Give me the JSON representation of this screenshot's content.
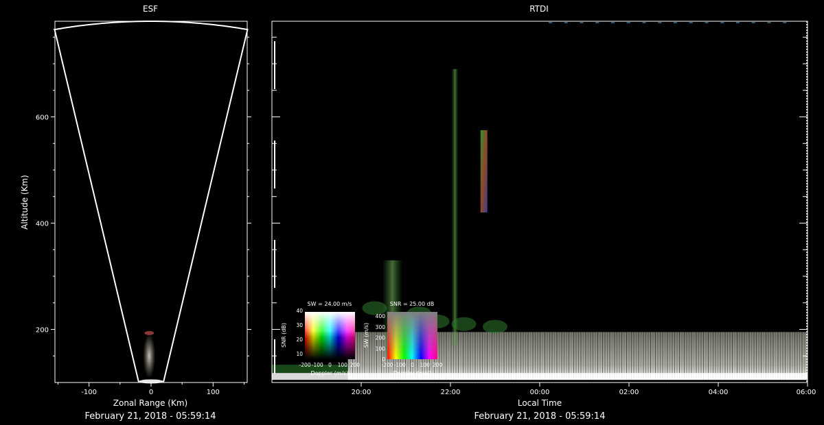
{
  "chart_data": [
    {
      "type": "heatmap",
      "panel": "esf",
      "title": "ESF",
      "xlabel": "Zonal Range (Km)",
      "ylabel": "Altitude (Km)",
      "xlim": [
        -155,
        155
      ],
      "ylim": [
        100,
        780
      ],
      "xticks": [
        -100,
        0,
        100
      ],
      "yticks": [
        200,
        400,
        600
      ],
      "grid": false,
      "beam_half_angle_deg": 11.5,
      "max_range_km": 780,
      "footer": "February 21, 2018 - 05:59:14"
    },
    {
      "type": "heatmap",
      "panel": "rtdi",
      "title": "RTDI",
      "xlabel": "Local Time",
      "xlim_hours": [
        18.0,
        30.0
      ],
      "xticks": [
        "20:00",
        "22:00",
        "00:00",
        "02:00",
        "04:00",
        "06:00"
      ],
      "xtick_hours": [
        20,
        22,
        24,
        26,
        28,
        30
      ],
      "ylim": [
        100,
        780
      ],
      "grid": false,
      "footer": "February 21, 2018 - 05:59:14",
      "features": [
        {
          "kind": "bottomside-layer",
          "start_hour": 19.7,
          "end_hour": 30.0,
          "alt_low": 105,
          "alt_high": 195
        },
        {
          "kind": "plume",
          "hour": 22.1,
          "alt_low": 170,
          "alt_high": 690
        },
        {
          "kind": "plume",
          "hour": 22.75,
          "alt_low": 420,
          "alt_high": 575
        },
        {
          "kind": "plume",
          "hour": 20.7,
          "alt_low": 150,
          "alt_high": 330
        }
      ]
    },
    {
      "type": "heatmap",
      "panel": "colorbar-doppler-snr",
      "title": "SW = 24.00 m/s",
      "xlabel": "Doppler (m/s)",
      "ylabel": "SNR (dB)",
      "xticks": [
        "-200",
        "-100",
        "0",
        "100",
        "200"
      ],
      "yticks": [
        "10",
        "20",
        "30",
        "40"
      ]
    },
    {
      "type": "heatmap",
      "panel": "colorbar-doppler-sw",
      "title": "SNR = 25.00 dB",
      "xlabel": "Doppler (m/s)",
      "ylabel": "SW (m/s)",
      "xticks": [
        "-200",
        "-100",
        "0",
        "100",
        "200"
      ],
      "yticks": [
        "0",
        "100",
        "200",
        "300",
        "400"
      ]
    }
  ]
}
